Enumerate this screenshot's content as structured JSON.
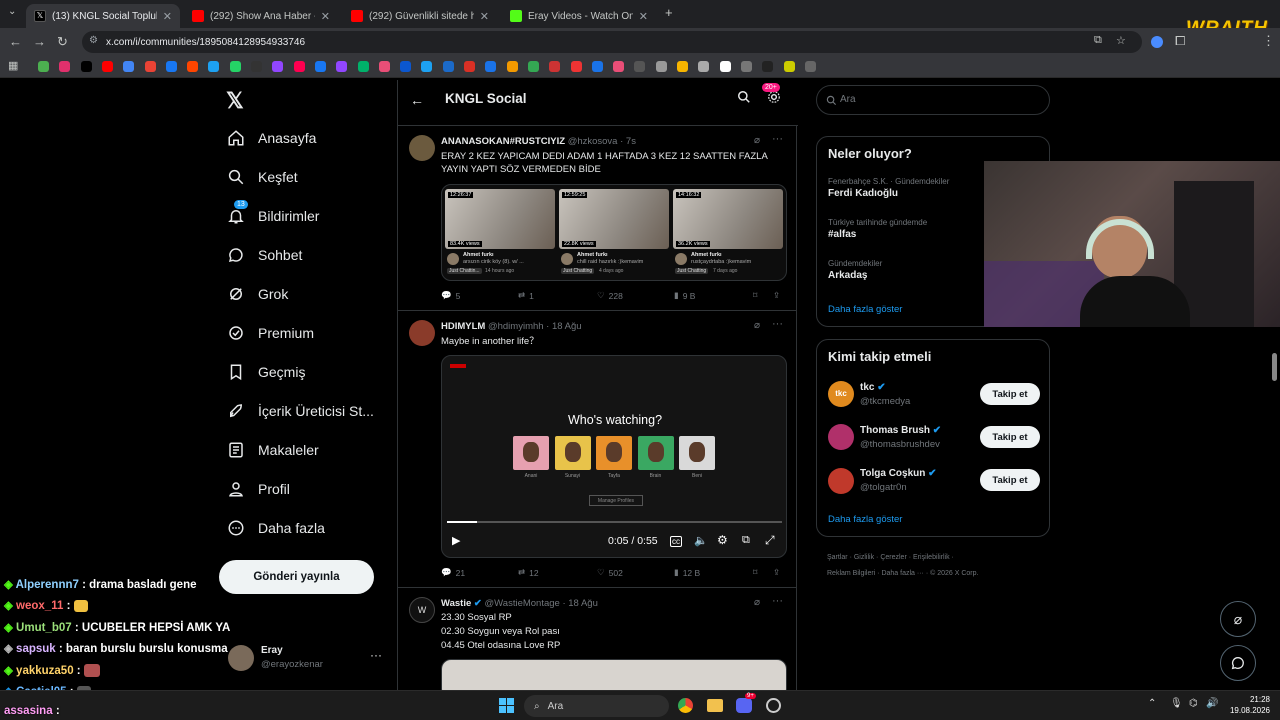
{
  "browser": {
    "tabs": [
      {
        "title": "(13) KNGL Social Topluluk / X",
        "fav": "#000000"
      },
      {
        "title": "(292) Show Ana Haber - YouTub",
        "fav": "#ff0000"
      },
      {
        "title": "(292) Güvenlikli sitede hırsız şo",
        "fav": "#ff0000"
      },
      {
        "title": "Eray Videos - Watch On-Deman",
        "fav": "#53fc18"
      }
    ],
    "url": "x.com/i/communities/1895084128954933746",
    "overlay_logo": "WRAITH"
  },
  "nav": {
    "items": [
      "Anasayfa",
      "Keşfet",
      "Bildirimler",
      "Sohbet",
      "Grok",
      "Premium",
      "Geçmiş",
      "İçerik Üreticisi St...",
      "Makaleler",
      "Profil",
      "Daha fazla"
    ],
    "notif_badge": "13",
    "post_button": "Gönderi yayınla",
    "account": {
      "name": "Eray",
      "handle": "@erayozkenar"
    }
  },
  "main": {
    "title": "KNGL Social",
    "badge": "20+",
    "posts": [
      {
        "name": "ANANASOKAN#RUSTCIYIZ",
        "meta": "@hzkosova · 7s",
        "text": "ERAY 2 KEZ YAPICAM DEDI ADAM 1 HAFTADA 3 KEZ 12 SAATTEN FAZLA YAYIN YAPTI SÖZ VERMEDEN BİDE",
        "thumbs": [
          {
            "dur": "12:26:37",
            "views": "83.4K views",
            "ch": "Ahmet furkı",
            "title": "arsızın cirik köy (8). w/ ...",
            "tag": "Just Chattin...",
            "ago": "14 hours ago"
          },
          {
            "dur": "12:59:25",
            "views": "22.8K views",
            "ch": "Ahmet furkı",
            "title": "chill raid hazırlık :)kemavim",
            "tag": "Just Chatting",
            "ago": "4 days ago"
          },
          {
            "dur": "14:16:32",
            "views": "36.2K views",
            "ch": "Ahmet furkı",
            "title": "rustçaydrtaba :)kemavim",
            "tag": "Just Chatting",
            "ago": "7 days ago"
          }
        ],
        "replies": "5",
        "reposts": "1",
        "likes": "228",
        "views": "9 B"
      },
      {
        "name": "HDIMYLM",
        "meta": "@hdimyimhh · 18 Ağu",
        "text": "Maybe in another life？",
        "video": {
          "prompt": "Who's watching?",
          "profiles": [
            "Anani",
            "Sunayi",
            "Tayfa",
            "Brain",
            "Beni"
          ],
          "manage": "Manage Profiles",
          "time": "0:05 / 0:55",
          "progress": 0.09
        },
        "replies": "21",
        "reposts": "12",
        "likes": "502",
        "views": "12 B"
      },
      {
        "name": "Wastie",
        "meta": "@WastieMontage · 18 Ağu",
        "lines": [
          "23.30 Sosyal RP",
          "02.30 Soygun veya Rol pası",
          "04.45 Otel odasına Love RP"
        ]
      }
    ]
  },
  "right": {
    "search_placeholder": "Ara",
    "trends_title": "Neler oluyor?",
    "trends": [
      {
        "ctx": "Fenerbahçe S.K. · Gündemdekiler",
        "name": "Ferdi Kadıoğlu"
      },
      {
        "ctx": "Türkiye tarihinde gündemde",
        "name": "#alfas"
      },
      {
        "ctx": "Gündemdekiler",
        "name": "Arkadaş"
      }
    ],
    "show_more": "Daha fazla göster",
    "who_title": "Kimi takip etmeli",
    "who": [
      {
        "name": "tkc",
        "handle": "@tkcmedya",
        "color": "#e08a1e",
        "initials": "tkc"
      },
      {
        "name": "Thomas Brush",
        "handle": "@thomasbrushdev",
        "color": "#b0306a",
        "initials": ""
      },
      {
        "name": "Tolga Coşkun",
        "handle": "@tolgatr0n",
        "color": "#c0392b",
        "initials": ""
      }
    ],
    "follow_label": "Takip et",
    "footer": [
      "Şartlar",
      "Gizlilik",
      "Çerezler",
      "Erişilebilirlik",
      "Reklam Bilgileri",
      "Daha fazla ···",
      "© 2026 X Corp."
    ]
  },
  "chat": [
    {
      "user": "Alperennn7",
      "msg": ": drama basladı gene"
    },
    {
      "user": "weox_11",
      "msg": ":"
    },
    {
      "user": "Umut_b07",
      "msg": ": UCUBELER HEPSİ AMK YA"
    },
    {
      "user": "sapsuk",
      "msg": ": baran burslu burslu konusma"
    },
    {
      "user": "yakkuza50",
      "msg": ":"
    },
    {
      "user": "Castiel05",
      "msg": ":"
    },
    {
      "user": "assasina",
      "msg": ":"
    }
  ],
  "taskbar": {
    "search": "Ara",
    "time": "21:28",
    "date": "19.08.2026",
    "discord_badge": "9+"
  }
}
